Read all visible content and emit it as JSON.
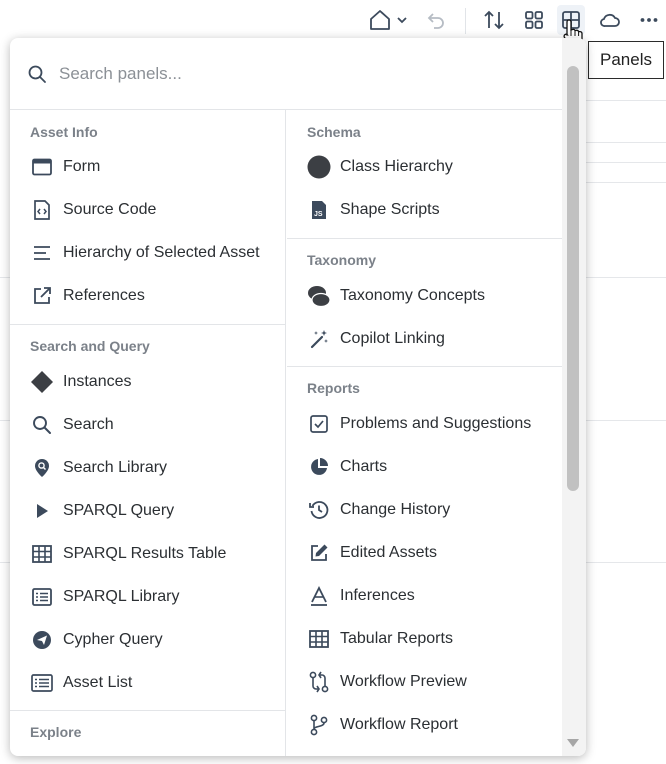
{
  "toolbar": {
    "tooltip": "Panels"
  },
  "search": {
    "placeholder": "Search panels..."
  },
  "left_sections": [
    {
      "title": "Asset Info",
      "items": [
        {
          "label": "Form",
          "icon": "form-icon"
        },
        {
          "label": "Source Code",
          "icon": "source-code-icon"
        },
        {
          "label": "Hierarchy of Selected Asset",
          "icon": "hierarchy-icon"
        },
        {
          "label": "References",
          "icon": "external-link-icon"
        }
      ]
    },
    {
      "title": "Search and Query",
      "items": [
        {
          "label": "Instances",
          "icon": "diamond-icon"
        },
        {
          "label": "Search",
          "icon": "search-icon"
        },
        {
          "label": "Search Library",
          "icon": "search-pin-icon"
        },
        {
          "label": "SPARQL Query",
          "icon": "play-icon"
        },
        {
          "label": "SPARQL Results Table",
          "icon": "table-icon"
        },
        {
          "label": "SPARQL Library",
          "icon": "list-box-icon"
        },
        {
          "label": "Cypher Query",
          "icon": "send-circle-icon"
        },
        {
          "label": "Asset List",
          "icon": "asset-list-icon"
        }
      ]
    },
    {
      "title": "Explore",
      "items": []
    }
  ],
  "right_sections": [
    {
      "title": "Schema",
      "items": [
        {
          "label": "Class Hierarchy",
          "icon": "circle-icon"
        },
        {
          "label": "Shape Scripts",
          "icon": "js-file-icon"
        }
      ]
    },
    {
      "title": "Taxonomy",
      "items": [
        {
          "label": "Taxonomy Concepts",
          "icon": "concepts-icon"
        },
        {
          "label": "Copilot Linking",
          "icon": "magic-wand-icon"
        }
      ]
    },
    {
      "title": "Reports",
      "items": [
        {
          "label": "Problems and Suggestions",
          "icon": "checkbox-icon"
        },
        {
          "label": "Charts",
          "icon": "pie-chart-icon"
        },
        {
          "label": "Change History",
          "icon": "history-icon"
        },
        {
          "label": "Edited Assets",
          "icon": "edit-square-icon"
        },
        {
          "label": "Inferences",
          "icon": "inference-icon"
        },
        {
          "label": "Tabular Reports",
          "icon": "table-icon"
        },
        {
          "label": "Workflow Preview",
          "icon": "workflow-preview-icon"
        },
        {
          "label": "Workflow Report",
          "icon": "branch-icon"
        }
      ]
    }
  ],
  "colors": {
    "icon": "#3c4a5c",
    "text": "#2b2f33",
    "section_title": "#7b8189",
    "divider": "#e3e5e8"
  }
}
